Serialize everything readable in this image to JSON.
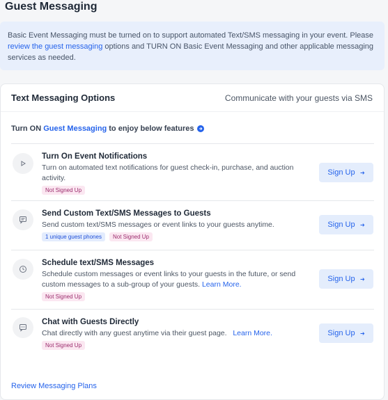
{
  "page": {
    "title": "Guest Messaging"
  },
  "notice": {
    "text_before": "Basic Event Messaging must be turned on to support automated Text/SMS messaging in your event. Please ",
    "link": "review the guest messaging",
    "text_after": " options and TURN ON Basic Event Messaging and other applicable messaging services as needed."
  },
  "card": {
    "title": "Text Messaging Options",
    "subtitle": "Communicate with your guests via SMS",
    "turn_on": {
      "prefix": "Turn ON",
      "link": "Guest Messaging",
      "suffix": "to enjoy below features"
    },
    "options": [
      {
        "icon": "play-icon",
        "title": "Turn On Event Notifications",
        "desc": "Turn on automated text notifications for guest check-in, purchase, and auction activity.",
        "link": "",
        "badges": [
          {
            "text": "Not Signed Up",
            "kind": "status"
          }
        ],
        "button": "Sign Up"
      },
      {
        "icon": "message-icon",
        "title": "Send Custom Text/SMS Messages to Guests",
        "desc": "Send custom text/SMS messages or event links to your guests anytime.",
        "link": "",
        "badges": [
          {
            "text": "1 unique guest phones",
            "kind": "info"
          },
          {
            "text": "Not Signed Up",
            "kind": "status"
          }
        ],
        "button": "Sign Up"
      },
      {
        "icon": "clock-icon",
        "title": "Schedule text/SMS Messages",
        "desc": "Schedule custom messages or event links to your guests in the future, or send custom messages to a sub-group of your guests.",
        "link": "Learn More.",
        "badges": [
          {
            "text": "Not Signed Up",
            "kind": "status"
          }
        ],
        "button": "Sign Up"
      },
      {
        "icon": "chat-icon",
        "title": "Chat with Guests Directly",
        "desc": "Chat directly with any guest anytime via their guest page.",
        "link": "Learn More.",
        "badges": [
          {
            "text": "Not Signed Up",
            "kind": "status"
          }
        ],
        "button": "Sign Up"
      }
    ],
    "footer_link": "Review Messaging Plans"
  },
  "colors": {
    "accent": "#2563eb",
    "notice_bg": "#e8effc",
    "badge_status_bg": "#fbe7f1",
    "badge_info_bg": "#e3ecfd"
  }
}
